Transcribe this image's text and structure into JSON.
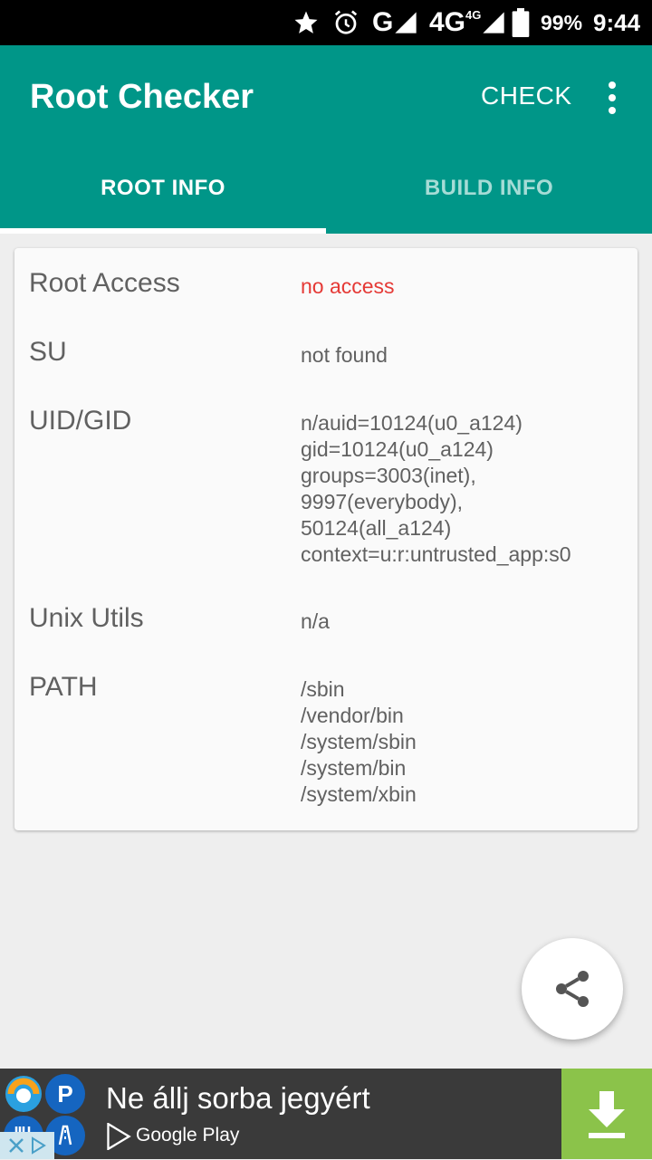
{
  "status_bar": {
    "signal_label": "G",
    "network_label": "4G",
    "network_sub": "4G",
    "battery": "99%",
    "time": "9:44"
  },
  "app_bar": {
    "title": "Root Checker",
    "action": "CHECK"
  },
  "tabs": [
    {
      "label": "ROOT INFO",
      "selected": true
    },
    {
      "label": "BUILD INFO",
      "selected": false
    }
  ],
  "root_info": {
    "rows": [
      {
        "label": "Root Access",
        "value": "no access"
      },
      {
        "label": "SU",
        "value": "not found"
      },
      {
        "label": "UID/GID",
        "value": "n/auid=10124(u0_a124)\ngid=10124(u0_a124)\ngroups=3003(inet),\n9997(everybody),\n50124(all_a124)\ncontext=u:r:untrusted_app:s0"
      },
      {
        "label": "Unix Utils",
        "value": "n/a"
      },
      {
        "label": "PATH",
        "value": "/sbin\n/vendor/bin\n/system/sbin\n/system/bin\n/system/xbin"
      }
    ]
  },
  "ad": {
    "title": "Ne állj sorba jegyért",
    "store": "Google Play",
    "parking_letter": "P"
  },
  "colors": {
    "primary": "#009688",
    "accent_tab_inactive": "#a6dcd6",
    "error": "#e53935",
    "ad_background": "#3a3a3a",
    "ad_download": "#8bc34a"
  },
  "icons": {
    "status": [
      "star-icon",
      "alarm-icon",
      "signal-icon",
      "battery-icon"
    ],
    "fab": "share-icon",
    "menu": "more-vert-icon",
    "ad_download": "download-icon"
  }
}
